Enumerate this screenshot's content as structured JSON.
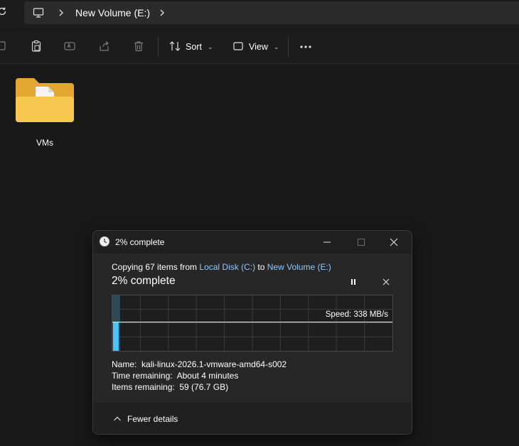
{
  "address": {
    "location": "New Volume (E:)",
    "icons": {
      "refresh": "refresh-icon",
      "pc": "this-pc-icon",
      "chevron": "chevron-right-icon"
    }
  },
  "commandbar": {
    "sort_label": "Sort",
    "view_label": "View",
    "icons": [
      "copy-icon",
      "paste-icon",
      "rename-icon",
      "share-icon",
      "delete-icon",
      "sort-icon",
      "view-icon",
      "more-icon"
    ]
  },
  "content": {
    "items": [
      {
        "name": "VMs",
        "type": "folder"
      }
    ]
  },
  "dialog": {
    "title": "2% complete",
    "copy_prefix": "Copying 67 items from ",
    "source": "Local Disk (C:)",
    "copy_middle": " to ",
    "destination": "New Volume (E:)",
    "percent_label": "2% complete",
    "progress_fraction": 0.02,
    "speed": "Speed: 338 MB/s",
    "details": {
      "name_label": "Name:",
      "name_value": "kali-linux-2026.1-vmware-amd64-s002",
      "time_label": "Time remaining:",
      "time_value": "About 4 minutes",
      "items_label": "Items remaining:",
      "items_value": "59 (76.7 GB)"
    },
    "fewer_details": "Fewer details",
    "colors": {
      "graph_fill": "#4fc3f7",
      "link": "#8ec8ff"
    }
  }
}
